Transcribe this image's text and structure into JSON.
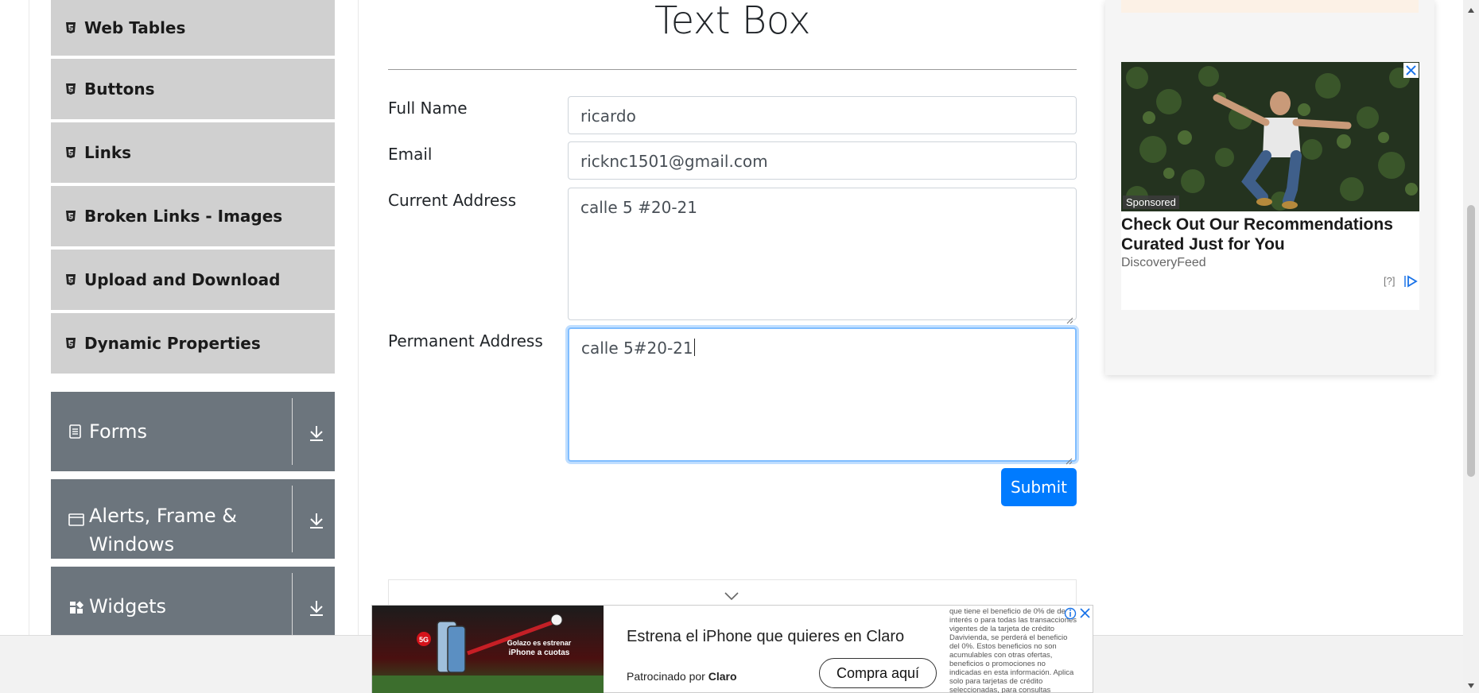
{
  "page": {
    "title": "Text Box"
  },
  "sidebar": {
    "items": [
      {
        "label": "Web Tables",
        "icon": "html5-icon"
      },
      {
        "label": "Buttons",
        "icon": "html5-icon"
      },
      {
        "label": "Links",
        "icon": "html5-icon"
      },
      {
        "label": "Broken Links - Images",
        "icon": "html5-icon"
      },
      {
        "label": "Upload and Download",
        "icon": "html5-icon"
      },
      {
        "label": "Dynamic Properties",
        "icon": "html5-icon"
      }
    ],
    "groups": [
      {
        "label": "Forms",
        "icon": "form-icon"
      },
      {
        "label": "Alerts, Frame & Windows",
        "icon": "window-icon"
      },
      {
        "label": "Widgets",
        "icon": "widgets-icon"
      }
    ]
  },
  "form": {
    "full_name": {
      "label": "Full Name",
      "value": "ricardo"
    },
    "email": {
      "label": "Email",
      "value": "ricknc1501@gmail.com"
    },
    "current_address": {
      "label": "Current Address",
      "value": "calle 5 #20-21"
    },
    "permanent_address": {
      "label": "Permanent Address",
      "value": "calle 5#20-21"
    },
    "submit_label": "Submit"
  },
  "right_ad": {
    "badge": "Sponsored",
    "headline": "Check Out Our Recommendations Curated Just for You",
    "source": "DiscoveryFeed",
    "info": "[?]"
  },
  "bottom_ad": {
    "image_text": "Golazo es estrenar iPhone a cuotas",
    "headline": "Estrena el iPhone que quieres en Claro",
    "sponsor_prefix": "Patrocinado por",
    "sponsor_name": "Claro",
    "cta": "Compra aquí",
    "fine_print": "que tiene el beneficio de 0% de de interés o para todas las transacciones vigentes de la tarjeta de crédito Davivienda, se perderá el beneficio del 0%. Estos beneficios no son acumulables con otras ofertas, beneficios o promociones no indicadas en esta información. Aplica solo para tarjetas de crédito seleccionadas, para consultas"
  },
  "colors": {
    "primary": "#007bff",
    "sidebar_item_bg": "#d0d0d0",
    "group_bg": "#6c757d"
  }
}
